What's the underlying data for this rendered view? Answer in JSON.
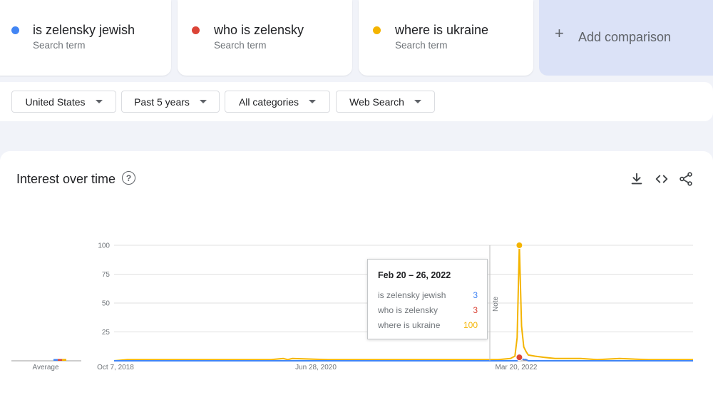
{
  "terms": [
    {
      "name": "is zelensky jewish",
      "sub": "Search term",
      "color": "#4285f4"
    },
    {
      "name": "who is zelensky",
      "sub": "Search term",
      "color": "#db4437"
    },
    {
      "name": "where is ukraine",
      "sub": "Search term",
      "color": "#f4b400"
    }
  ],
  "add_comparison": {
    "label": "Add comparison",
    "icon": "plus-icon"
  },
  "filters": [
    {
      "label": "United States"
    },
    {
      "label": "Past 5 years"
    },
    {
      "label": "All categories"
    },
    {
      "label": "Web Search"
    }
  ],
  "panel": {
    "title": "Interest over time",
    "icons": [
      "help-icon",
      "download-icon",
      "embed-icon",
      "share-icon"
    ]
  },
  "tooltip": {
    "date": "Feb 20 – 26, 2022",
    "rows": [
      {
        "term": "is zelensky jewish",
        "value": "3",
        "color": "#4285f4"
      },
      {
        "term": "who is zelensky",
        "value": "3",
        "color": "#db4437"
      },
      {
        "term": "where is ukraine",
        "value": "100",
        "color": "#f4b400"
      }
    ]
  },
  "chart_data": {
    "type": "line",
    "y_ticks": [
      "100",
      "75",
      "50",
      "25"
    ],
    "ylim": [
      0,
      100
    ],
    "x_tick_labels": [
      "Oct 7, 2018",
      "Jun 28, 2020",
      "Mar 20, 2022"
    ],
    "average_label": "Average",
    "note_label": "Note",
    "grid": true,
    "x_dates": [
      "2018-08-26",
      "2018-10-07",
      "2019-03-01",
      "2019-08-01",
      "2020-01-01",
      "2020-02-09",
      "2020-02-23",
      "2020-03-08",
      "2020-06-28",
      "2020-11-01",
      "2021-04-01",
      "2021-09-01",
      "2021-12-15",
      "2022-01-23",
      "2022-02-06",
      "2022-02-13",
      "2022-02-20",
      "2022-02-27",
      "2022-03-06",
      "2022-03-13",
      "2022-03-20",
      "2022-04-10",
      "2022-05-08",
      "2022-06-12",
      "2022-09-01",
      "2022-10-23",
      "2023-01-01",
      "2023-04-01",
      "2023-08-20"
    ],
    "series": [
      {
        "name": "is zelensky jewish",
        "color": "#4285f4",
        "values": [
          0,
          0,
          0,
          0,
          0,
          0,
          0,
          0,
          0,
          0,
          0,
          0,
          0,
          0,
          0,
          0,
          3,
          2,
          1,
          1,
          0,
          0,
          0,
          0,
          0,
          0,
          0,
          0,
          0
        ],
        "average": 0
      },
      {
        "name": "who is zelensky",
        "color": "#db4437",
        "values": [
          0,
          0,
          0,
          0,
          0,
          0,
          0,
          0,
          0,
          0,
          0,
          0,
          0,
          0,
          0,
          0,
          3,
          2,
          1,
          1,
          0,
          0,
          0,
          0,
          0,
          0,
          0,
          0,
          0
        ],
        "average": 0
      },
      {
        "name": "where is ukraine",
        "color": "#f4b400",
        "values": [
          0,
          1,
          1,
          1,
          1,
          2,
          1,
          2,
          1,
          1,
          1,
          1,
          1,
          2,
          4,
          20,
          100,
          30,
          12,
          8,
          5,
          4,
          3,
          2,
          2,
          1,
          2,
          1,
          1
        ],
        "average": 1
      }
    ]
  }
}
